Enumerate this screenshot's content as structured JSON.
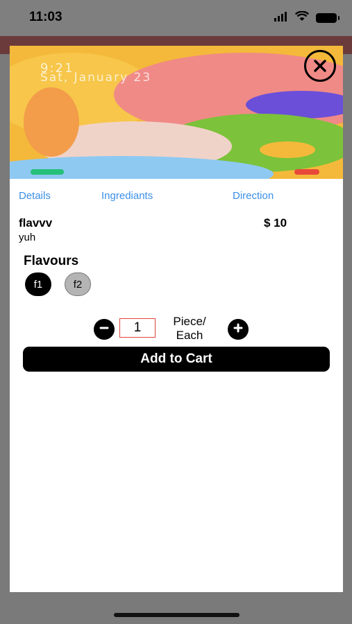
{
  "status_bar": {
    "time": "11:03",
    "icons": [
      "signal-icon",
      "wifi-icon",
      "battery-icon"
    ]
  },
  "hero_image": {
    "lock_time": "9:21",
    "lock_date": "Sat, January 23",
    "colors": {
      "background": "#f4b93a",
      "pink": "#f08a86",
      "green": "#7cc23a",
      "purple": "#6b4fd8",
      "blue": "#8ec9f2"
    }
  },
  "close_button": {
    "icon": "close-icon"
  },
  "tabs": [
    {
      "label": "Details"
    },
    {
      "label": "Ingrediants"
    },
    {
      "label": "Direction"
    }
  ],
  "product": {
    "name": "flavvv",
    "price": "$ 10",
    "description": "yuh"
  },
  "flavours": {
    "heading": "Flavours",
    "options": [
      {
        "label": "f1",
        "selected": true
      },
      {
        "label": "f2",
        "selected": false
      }
    ]
  },
  "quantity": {
    "value": "1",
    "unit_line1": "Piece/",
    "unit_line2": "Each",
    "decrement_icon": "minus-icon",
    "increment_icon": "plus-icon"
  },
  "cart": {
    "button_label": "Add to Cart"
  },
  "colors": {
    "accent_link": "#3b8fe8",
    "qty_border": "#e0443d",
    "primary_button": "#000000"
  }
}
